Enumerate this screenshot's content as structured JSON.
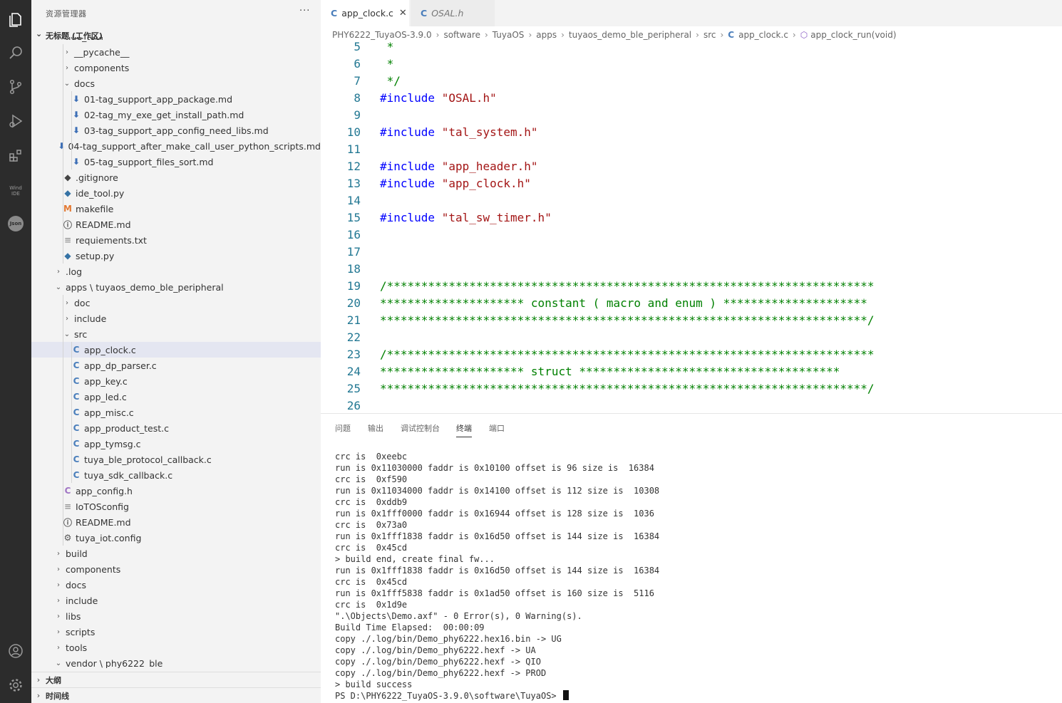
{
  "sidebar": {
    "title": "资源管理器",
    "more": "···",
    "workspace": "无标题 (工作区)",
    "outline": "大纲",
    "timeline": "时间线"
  },
  "tree": [
    {
      "label": ".ide_tool",
      "depth": 2,
      "kind": "folder-open",
      "icon": "chevron-down-icon"
    },
    {
      "label": "__pycache__",
      "depth": 3,
      "kind": "folder"
    },
    {
      "label": "components",
      "depth": 3,
      "kind": "folder"
    },
    {
      "label": "docs",
      "depth": 3,
      "kind": "folder-open"
    },
    {
      "label": "01-tag_support_app_package.md",
      "depth": 4,
      "kind": "md"
    },
    {
      "label": "02-tag_my_exe_get_install_path.md",
      "depth": 4,
      "kind": "md"
    },
    {
      "label": "03-tag_support_app_config_need_libs.md",
      "depth": 4,
      "kind": "md"
    },
    {
      "label": "04-tag_support_after_make_call_user_python_scripts.md",
      "depth": 4,
      "kind": "md"
    },
    {
      "label": "05-tag_support_files_sort.md",
      "depth": 4,
      "kind": "md"
    },
    {
      "label": ".gitignore",
      "depth": 3,
      "kind": "git"
    },
    {
      "label": "ide_tool.py",
      "depth": 3,
      "kind": "py"
    },
    {
      "label": "makefile",
      "depth": 3,
      "kind": "make"
    },
    {
      "label": "README.md",
      "depth": 3,
      "kind": "info"
    },
    {
      "label": "requiements.txt",
      "depth": 3,
      "kind": "txt"
    },
    {
      "label": "setup.py",
      "depth": 3,
      "kind": "py"
    },
    {
      "label": ".log",
      "depth": 2,
      "kind": "folder"
    },
    {
      "label": "apps \\ tuyaos_demo_ble_peripheral",
      "depth": 2,
      "kind": "folder-open"
    },
    {
      "label": "doc",
      "depth": 3,
      "kind": "folder"
    },
    {
      "label": "include",
      "depth": 3,
      "kind": "folder"
    },
    {
      "label": "src",
      "depth": 3,
      "kind": "folder-open"
    },
    {
      "label": "app_clock.c",
      "depth": 4,
      "kind": "c",
      "selected": true
    },
    {
      "label": "app_dp_parser.c",
      "depth": 4,
      "kind": "c"
    },
    {
      "label": "app_key.c",
      "depth": 4,
      "kind": "c"
    },
    {
      "label": "app_led.c",
      "depth": 4,
      "kind": "c"
    },
    {
      "label": "app_misc.c",
      "depth": 4,
      "kind": "c"
    },
    {
      "label": "app_product_test.c",
      "depth": 4,
      "kind": "c"
    },
    {
      "label": "app_tymsg.c",
      "depth": 4,
      "kind": "c"
    },
    {
      "label": "tuya_ble_protocol_callback.c",
      "depth": 4,
      "kind": "c"
    },
    {
      "label": "tuya_sdk_callback.c",
      "depth": 4,
      "kind": "c"
    },
    {
      "label": "app_config.h",
      "depth": 3,
      "kind": "h"
    },
    {
      "label": "IoTOSconfig",
      "depth": 3,
      "kind": "txt"
    },
    {
      "label": "README.md",
      "depth": 3,
      "kind": "info"
    },
    {
      "label": "tuya_iot.config",
      "depth": 3,
      "kind": "gear"
    },
    {
      "label": "build",
      "depth": 2,
      "kind": "folder"
    },
    {
      "label": "components",
      "depth": 2,
      "kind": "folder"
    },
    {
      "label": "docs",
      "depth": 2,
      "kind": "folder"
    },
    {
      "label": "include",
      "depth": 2,
      "kind": "folder"
    },
    {
      "label": "libs",
      "depth": 2,
      "kind": "folder"
    },
    {
      "label": "scripts",
      "depth": 2,
      "kind": "folder"
    },
    {
      "label": "tools",
      "depth": 2,
      "kind": "folder"
    },
    {
      "label": "vendor \\ phy6222_ble",
      "depth": 2,
      "kind": "folder-open"
    }
  ],
  "tabs": [
    {
      "label": "app_clock.c",
      "active": true,
      "close": "✕"
    },
    {
      "label": "OSAL.h",
      "active": false
    }
  ],
  "breadcrumbs": [
    "PHY6222_TuyaOS-3.9.0",
    "software",
    "TuyaOS",
    "apps",
    "tuyaos_demo_ble_peripheral",
    "src",
    "app_clock.c",
    "app_clock_run(void)"
  ],
  "code": [
    {
      "n": "5",
      "t": " *"
    },
    {
      "n": "6",
      "t": " *"
    },
    {
      "n": "7",
      "t": " */"
    },
    {
      "n": "8",
      "kw": "#include",
      "s": " \"OSAL.h\""
    },
    {
      "n": "9",
      "t": ""
    },
    {
      "n": "10",
      "kw": "#include",
      "s": " \"tal_system.h\""
    },
    {
      "n": "11",
      "t": ""
    },
    {
      "n": "12",
      "kw": "#include",
      "s": " \"app_header.h\""
    },
    {
      "n": "13",
      "kw": "#include",
      "s": " \"app_clock.h\""
    },
    {
      "n": "14",
      "t": ""
    },
    {
      "n": "15",
      "kw": "#include",
      "s": " \"tal_sw_timer.h\""
    },
    {
      "n": "16",
      "t": ""
    },
    {
      "n": "17",
      "t": ""
    },
    {
      "n": "18",
      "t": ""
    },
    {
      "n": "19",
      "t": "/***********************************************************************"
    },
    {
      "n": "20",
      "t": "********************* constant ( macro and enum ) *********************"
    },
    {
      "n": "21",
      "t": "***********************************************************************/"
    },
    {
      "n": "22",
      "t": ""
    },
    {
      "n": "23",
      "t": "/***********************************************************************"
    },
    {
      "n": "24",
      "t": "********************* struct **************************************"
    },
    {
      "n": "25",
      "t": "***********************************************************************/"
    },
    {
      "n": "26",
      "t": ""
    }
  ],
  "panel_tabs": [
    "问题",
    "输出",
    "调试控制台",
    "终端",
    "端口"
  ],
  "terminal": [
    "crc is  0xeebc",
    "run is 0x11030000 faddr is 0x10100 offset is 96 size is  16384",
    "crc is  0xf590",
    "run is 0x11034000 faddr is 0x14100 offset is 112 size is  10308",
    "crc is  0xddb9",
    "run is 0x1fff0000 faddr is 0x16944 offset is 128 size is  1036",
    "crc is  0x73a0",
    "run is 0x1fff1838 faddr is 0x16d50 offset is 144 size is  16384",
    "crc is  0x45cd",
    "> build end, create final fw...",
    "run is 0x1fff1838 faddr is 0x16d50 offset is 144 size is  16384",
    "crc is  0x45cd",
    "run is 0x1fff5838 faddr is 0x1ad50 offset is 160 size is  5116",
    "crc is  0x1d9e",
    "\".\\Objects\\Demo.axf\" - 0 Error(s), 0 Warning(s).",
    "Build Time Elapsed:  00:00:09",
    "copy ./.log/bin/Demo_phy6222.hex16.bin -> UG",
    "copy ./.log/bin/Demo_phy6222.hexf -> UA",
    "copy ./.log/bin/Demo_phy6222.hexf -> QIO",
    "copy ./.log/bin/Demo_phy6222.hexf -> PROD",
    "> build success",
    "PS D:\\PHY6222_TuyaOS-3.9.0\\software\\TuyaOS> "
  ],
  "activity_icons": [
    "files-icon",
    "search-icon",
    "source-control-icon",
    "run-debug-icon",
    "extensions-icon",
    "wind-ide-icon",
    "json-icon",
    "account-icon",
    "settings-gear-icon"
  ],
  "wind_ide_label": "Wind IDE",
  "json_label": "Json"
}
